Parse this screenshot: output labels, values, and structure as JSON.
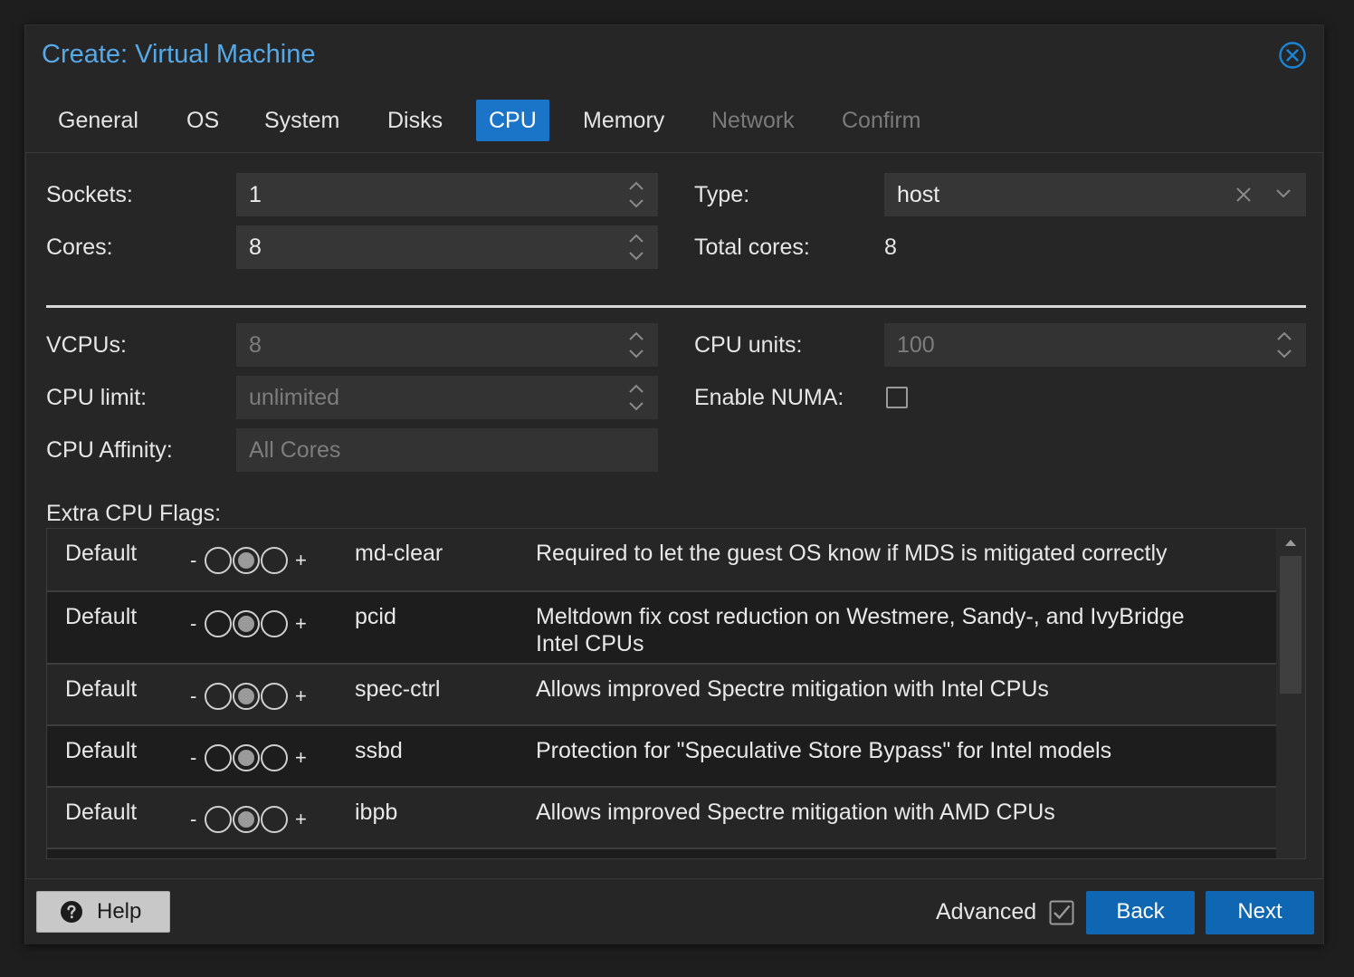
{
  "dialog": {
    "title": "Create: Virtual Machine",
    "close_icon": "close-circle-icon"
  },
  "tabs": [
    {
      "label": "General",
      "state": "normal"
    },
    {
      "label": "OS",
      "state": "normal"
    },
    {
      "label": "System",
      "state": "normal"
    },
    {
      "label": "Disks",
      "state": "normal"
    },
    {
      "label": "CPU",
      "state": "active"
    },
    {
      "label": "Memory",
      "state": "normal"
    },
    {
      "label": "Network",
      "state": "disabled"
    },
    {
      "label": "Confirm",
      "state": "disabled"
    }
  ],
  "basic": {
    "sockets_label": "Sockets:",
    "sockets_value": "1",
    "cores_label": "Cores:",
    "cores_value": "8",
    "type_label": "Type:",
    "type_value": "host",
    "total_cores_label": "Total cores:",
    "total_cores_value": "8"
  },
  "advanced": {
    "vcpus_label": "VCPUs:",
    "vcpus_value": "8",
    "cpu_limit_label": "CPU limit:",
    "cpu_limit_placeholder": "unlimited",
    "cpu_affinity_label": "CPU Affinity:",
    "cpu_affinity_placeholder": "All Cores",
    "cpu_units_label": "CPU units:",
    "cpu_units_placeholder": "100",
    "enable_numa_label": "Enable NUMA:",
    "enable_numa_checked": false
  },
  "flags": {
    "title": "Extra CPU Flags:",
    "rows": [
      {
        "state": "Default",
        "minus": "-",
        "plus": "+",
        "flag": "md-clear",
        "description": "Required to let the guest OS know if MDS is mitigated correctly"
      },
      {
        "state": "Default",
        "minus": "-",
        "plus": "+",
        "flag": "pcid",
        "description": "Meltdown fix cost reduction on Westmere, Sandy-, and IvyBridge Intel CPUs"
      },
      {
        "state": "Default",
        "minus": "-",
        "plus": "+",
        "flag": "spec-ctrl",
        "description": "Allows improved Spectre mitigation with Intel CPUs"
      },
      {
        "state": "Default",
        "minus": "-",
        "plus": "+",
        "flag": "ssbd",
        "description": "Protection for \"Speculative Store Bypass\" for Intel models"
      },
      {
        "state": "Default",
        "minus": "-",
        "plus": "+",
        "flag": "ibpb",
        "description": "Allows improved Spectre mitigation with AMD CPUs"
      }
    ]
  },
  "footer": {
    "help_label": "Help",
    "help_icon": "question-circle-icon",
    "advanced_label": "Advanced",
    "advanced_checked": true,
    "back_label": "Back",
    "next_label": "Next"
  },
  "colors": {
    "accent": "#1a75c8",
    "title": "#56a8e6",
    "button": "#0f67b3"
  }
}
